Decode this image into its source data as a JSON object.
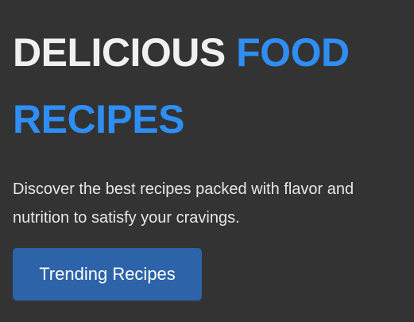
{
  "hero": {
    "title_main": "DELICIOUS ",
    "title_accent": "FOOD RECIPES",
    "description": "Discover the best recipes packed with flavor and nutrition to satisfy your cravings.",
    "cta_label": "Trending Recipes"
  },
  "colors": {
    "background": "#333333",
    "title_text": "#f0f0f0",
    "accent": "#2f8ef4",
    "button": "#2d63a8"
  }
}
